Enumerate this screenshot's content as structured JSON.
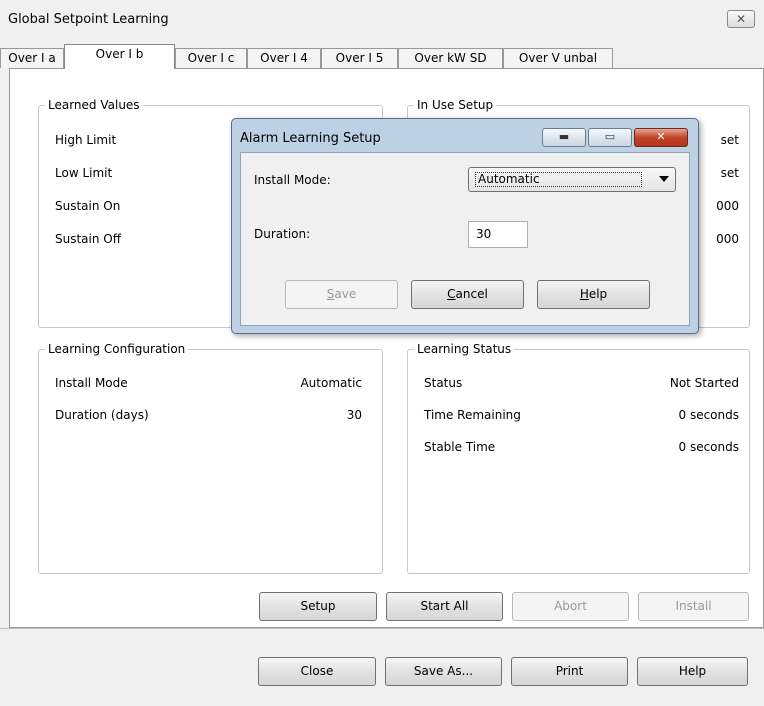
{
  "window": {
    "title": "Global Setpoint Learning",
    "close_glyph": "✕"
  },
  "tabs": [
    {
      "label": "Over I a"
    },
    {
      "label": "Over I b"
    },
    {
      "label": "Over I c"
    },
    {
      "label": "Over I 4"
    },
    {
      "label": "Over I 5"
    },
    {
      "label": "Over kW SD"
    },
    {
      "label": "Over V unbal"
    }
  ],
  "learned_values": {
    "title": "Learned Values",
    "rows": [
      {
        "label": "High Limit"
      },
      {
        "label": "Low Limit"
      },
      {
        "label": "Sustain On"
      },
      {
        "label": "Sustain Off"
      }
    ]
  },
  "in_use_setup": {
    "title": "In Use Setup",
    "partial_values": [
      "set",
      "set",
      "000",
      "000"
    ]
  },
  "learning_configuration": {
    "title": "Learning Configuration",
    "rows": [
      {
        "label": "Install Mode",
        "value": "Automatic"
      },
      {
        "label": "Duration (days)",
        "value": "30"
      }
    ]
  },
  "learning_status": {
    "title": "Learning Status",
    "rows": [
      {
        "label": "Status",
        "value": "Not Started"
      },
      {
        "label": "Time Remaining",
        "value": "0 seconds"
      },
      {
        "label": "Stable Time",
        "value": "0 seconds"
      }
    ]
  },
  "action_buttons": {
    "setup": "Setup",
    "start_all": "Start All",
    "abort": "Abort",
    "install": "Install"
  },
  "footer_buttons": {
    "close": "Close",
    "save_as": "Save As...",
    "print": "Print",
    "help": "Help"
  },
  "dialog": {
    "title": "Alarm Learning Setup",
    "install_mode_label": "Install Mode:",
    "install_mode_value": "Automatic",
    "duration_label": "Duration:",
    "duration_value": "30",
    "save_rest": "ave",
    "save_accel": "S",
    "cancel_accel": "C",
    "cancel_rest": "ancel",
    "help_accel": "H",
    "help_rest": "elp",
    "min_glyph": "▬",
    "max_glyph": "▭",
    "close_glyph": "✕"
  }
}
